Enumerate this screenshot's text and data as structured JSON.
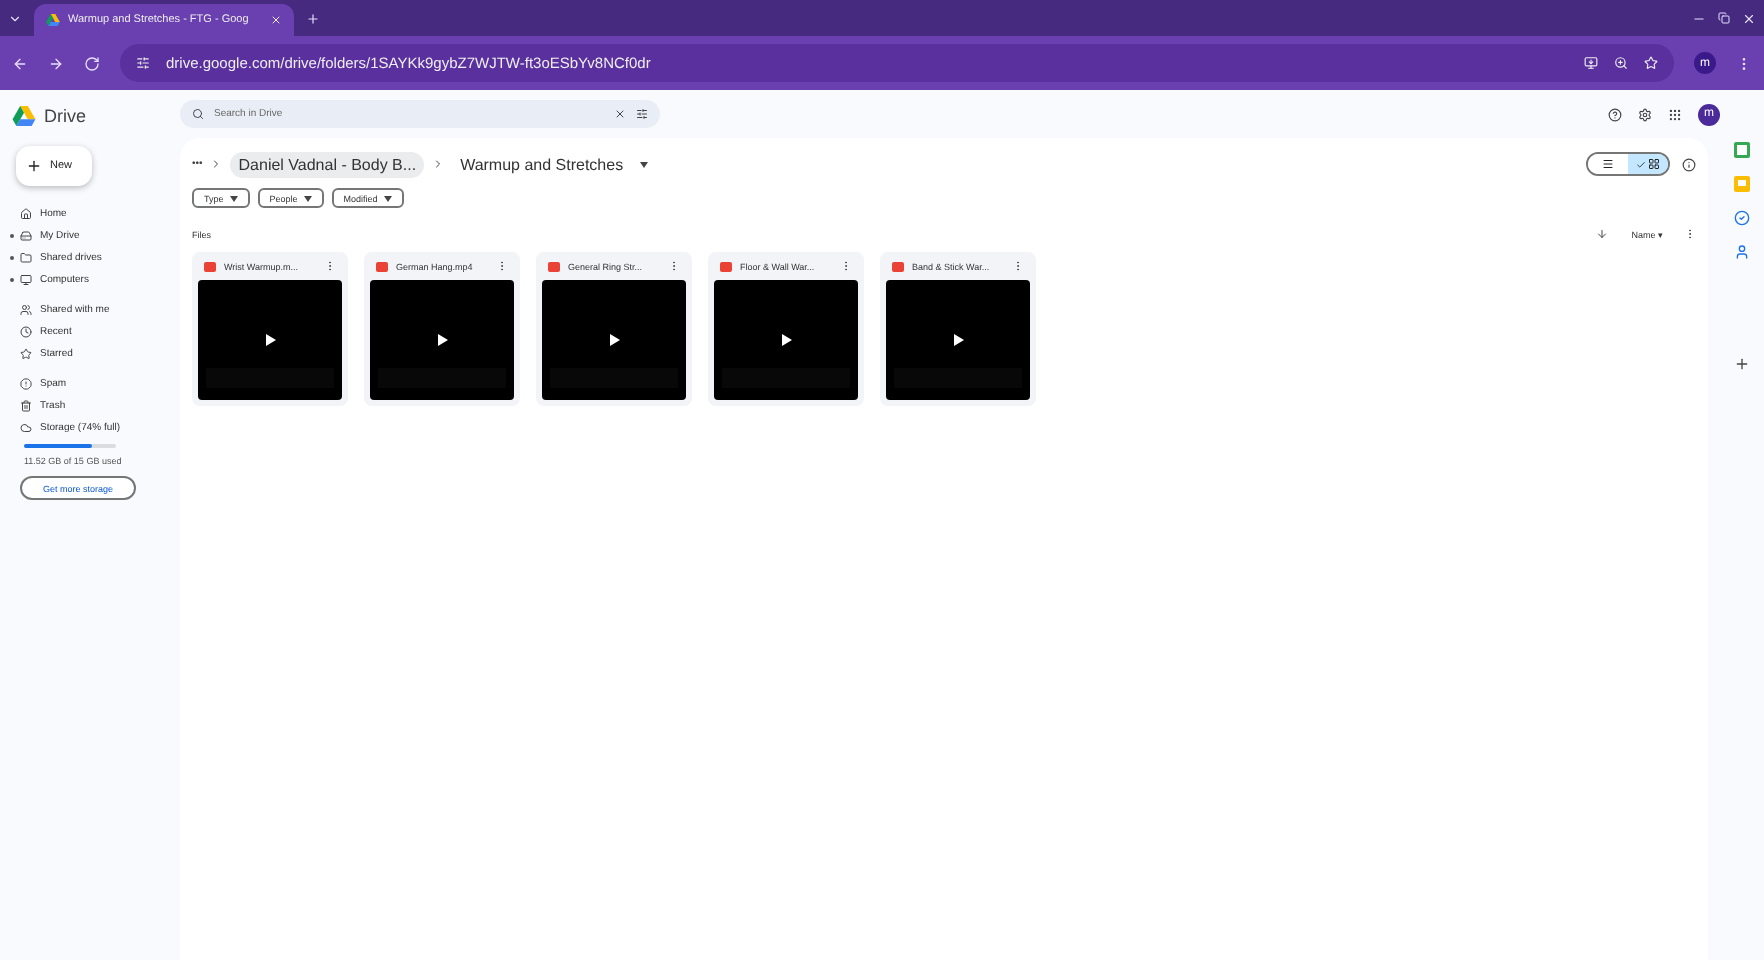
{
  "browser": {
    "tab_title": "Warmup and Stretches - FTG - Goog",
    "url": "drive.google.com/drive/folders/1SAYKk9gybZ7WJTW-ft3oESbYv8NCf0dr",
    "avatar": "m"
  },
  "app": {
    "name": "Drive",
    "new_label": "New",
    "search_placeholder": "Search in Drive",
    "avatar": "m"
  },
  "sidebar": {
    "items": [
      {
        "label": "Home",
        "expandable": false
      },
      {
        "label": "My Drive",
        "expandable": true
      },
      {
        "label": "Shared drives",
        "expandable": true
      },
      {
        "label": "Computers",
        "expandable": true
      },
      {
        "label": "Shared with me",
        "expandable": false
      },
      {
        "label": "Recent",
        "expandable": false
      },
      {
        "label": "Starred",
        "expandable": false
      },
      {
        "label": "Spam",
        "expandable": false
      },
      {
        "label": "Trash",
        "expandable": false
      },
      {
        "label": "Storage (74% full)",
        "expandable": false
      }
    ],
    "storage": {
      "level": 0.74,
      "used": "11.52 GB of 15 GB used",
      "button": "Get more storage"
    }
  },
  "breadcrumb": {
    "more": "•••",
    "parent": "Daniel Vadnal - Body B...",
    "current": "Warmup and Stretches"
  },
  "filters": [
    "Type",
    "People",
    "Modified"
  ],
  "view": {
    "list_selected": false,
    "grid_selected": true
  },
  "section_label": "Files",
  "sort": {
    "label": "Name",
    "caret": "▾"
  },
  "files": [
    {
      "name": "Wrist Warmup.m..."
    },
    {
      "name": "German Hang.mp4"
    },
    {
      "name": "General Ring Str..."
    },
    {
      "name": "Floor & Wall War..."
    },
    {
      "name": "Band & Stick War..."
    }
  ]
}
